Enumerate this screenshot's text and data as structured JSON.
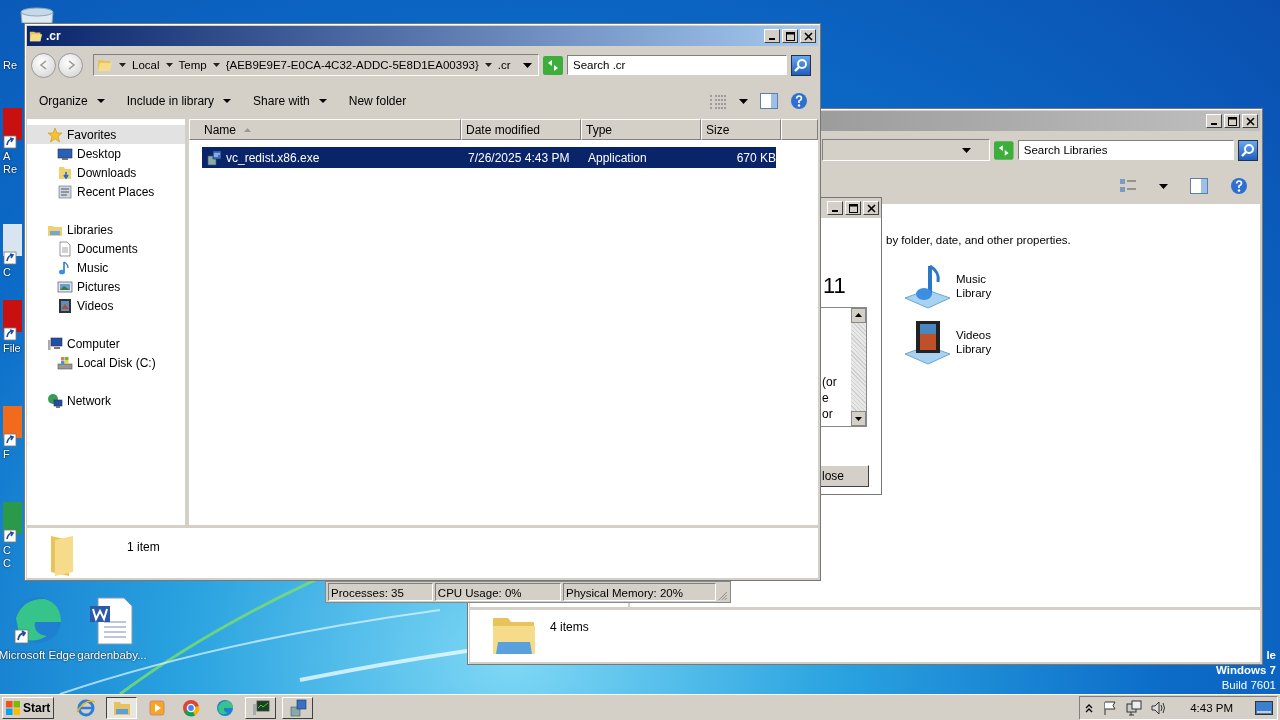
{
  "desktop": {
    "icons": [
      {
        "kind": "recycle",
        "lines": [
          "Re"
        ]
      },
      {
        "kind": "red-app",
        "lines": [
          "A",
          "Re"
        ]
      },
      {
        "kind": "blank-app",
        "lines": [
          "C"
        ]
      },
      {
        "kind": "red-app",
        "lines": [
          "File"
        ]
      },
      {
        "kind": "orange-app",
        "lines": [
          "F"
        ]
      },
      {
        "kind": "green-app",
        "lines": [
          "C",
          "C"
        ]
      }
    ],
    "shortcuts": [
      {
        "kind": "edge",
        "label": "Microsoft Edge"
      },
      {
        "kind": "word",
        "label": "gardenbaby..."
      }
    ],
    "os_text": [
      "le",
      "Windows 7",
      "Build 7601"
    ]
  },
  "libraries_window": {
    "search": {
      "placeholder": "Search Libraries"
    },
    "description": "by folder, date, and other properties.",
    "items": [
      {
        "kind": "music",
        "label": "Music Library"
      },
      {
        "kind": "videos",
        "label": "Videos Library"
      }
    ],
    "status": "4 items"
  },
  "task_manager": {
    "status": [
      "Processes: 35",
      "CPU Usage: 0%",
      "Physical Memory: 20%"
    ]
  },
  "dialog": {
    "heading": "11",
    "list_lines": [
      "(or",
      "e",
      "or"
    ],
    "button": "lose"
  },
  "explorer": {
    "title": ".cr",
    "breadcrumbs": [
      "Local",
      "Temp",
      "{AEB9E9E7-E0CA-4C32-ADDC-5E8D1EA00393}",
      ".cr"
    ],
    "search": {
      "placeholder": "Search .cr"
    },
    "toolbar": [
      {
        "label": "Organize",
        "dropdown": true
      },
      {
        "label": "Include in library",
        "dropdown": true
      },
      {
        "label": "Share with",
        "dropdown": true
      },
      {
        "label": "New folder",
        "dropdown": false
      }
    ],
    "nav": [
      {
        "kind": "star",
        "label": "Favorites",
        "selected": true,
        "children": [
          {
            "kind": "desktop",
            "label": "Desktop",
            "selected": false
          },
          {
            "kind": "downloads",
            "label": "Downloads",
            "selected": false
          },
          {
            "kind": "recent",
            "label": "Recent Places",
            "selected": false
          }
        ]
      },
      {
        "kind": "libraries",
        "label": "Libraries",
        "selected": false,
        "children": [
          {
            "kind": "documents",
            "label": "Documents",
            "selected": false
          },
          {
            "kind": "music",
            "label": "Music",
            "selected": false
          },
          {
            "kind": "pictures",
            "label": "Pictures",
            "selected": false
          },
          {
            "kind": "videos",
            "label": "Videos",
            "selected": false
          }
        ]
      },
      {
        "kind": "computer",
        "label": "Computer",
        "selected": false,
        "children": [
          {
            "kind": "disk",
            "label": "Local Disk (C:)",
            "selected": false
          }
        ]
      },
      {
        "kind": "network",
        "label": "Network",
        "selected": false
      }
    ],
    "columns": [
      {
        "label": "Name",
        "sorted": true
      },
      {
        "label": "Date modified",
        "sorted": false
      },
      {
        "label": "Type",
        "sorted": false
      },
      {
        "label": "Size",
        "sorted": false
      }
    ],
    "rows": [
      {
        "name": "vc_redist.x86.exe",
        "date": "7/26/2025 4:43 PM",
        "type": "Application",
        "size": "670 KB",
        "selected": true
      }
    ],
    "status": "1 item"
  },
  "taskbar": {
    "start": "Start",
    "apps": [
      {
        "kind": "ie",
        "open": false,
        "selected": false
      },
      {
        "kind": "explorer",
        "open": true,
        "selected": true
      },
      {
        "kind": "media",
        "open": false,
        "selected": false
      },
      {
        "kind": "chrome",
        "open": false,
        "selected": false
      },
      {
        "kind": "edge",
        "open": false,
        "selected": false
      },
      {
        "kind": "taskmgr",
        "open": true,
        "selected": false
      },
      {
        "kind": "installer",
        "open": true,
        "selected": false
      }
    ],
    "clock": "4:43 PM"
  }
}
